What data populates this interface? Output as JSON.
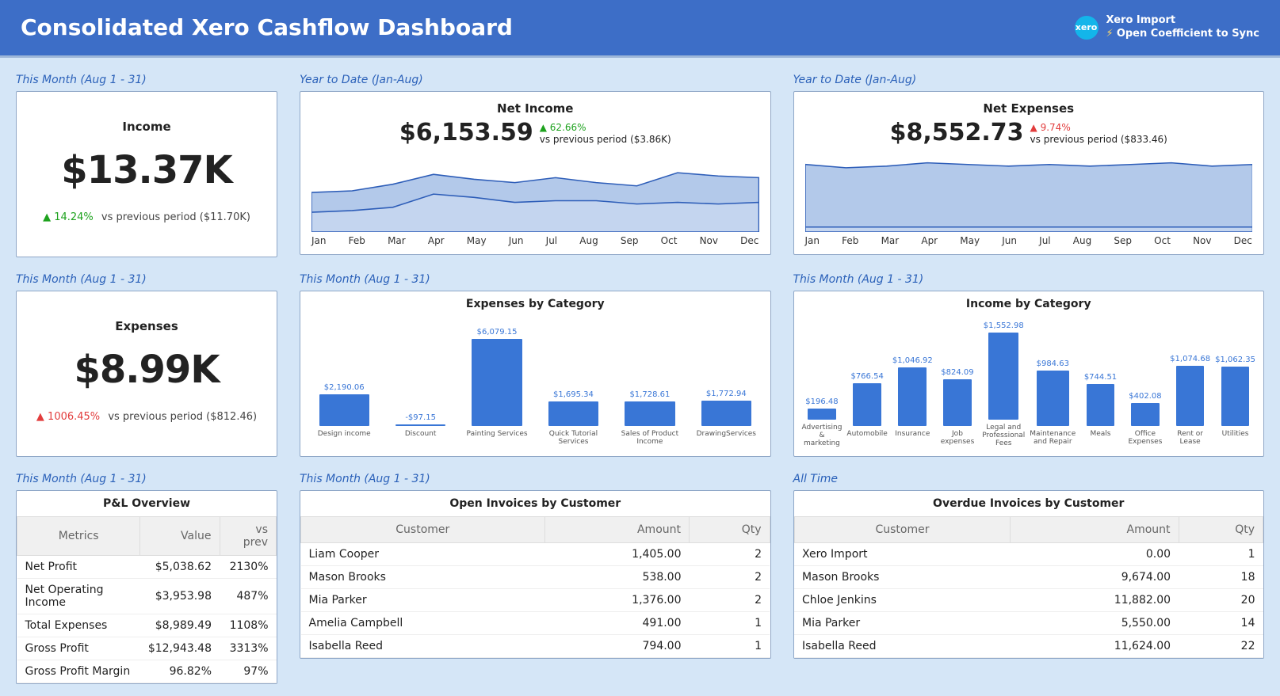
{
  "header": {
    "title": "Consolidated Xero Cashflow Dashboard",
    "import_label": "Xero Import",
    "sync_label": "Open Coefficient to Sync",
    "logo": "xero"
  },
  "labels": {
    "this_month": "This Month (Aug 1 - 31)",
    "ytd": "Year to Date (Jan-Aug)",
    "all_time": "All Time"
  },
  "income": {
    "title": "Income",
    "value": "$13.37K",
    "delta_pct": "14.24%",
    "delta_dir": "up",
    "prev": "vs previous period ($11.70K)"
  },
  "expenses": {
    "title": "Expenses",
    "value": "$8.99K",
    "delta_pct": "1006.45%",
    "delta_dir": "down",
    "prev": "vs previous period ($812.46)"
  },
  "net_income": {
    "title": "Net Income",
    "value": "$6,153.59",
    "delta_pct": "62.66%",
    "delta_dir": "up",
    "prev": "vs previous period ($3.86K)"
  },
  "net_expenses": {
    "title": "Net Expenses",
    "value": "$8,552.73",
    "delta_pct": "9.74%",
    "delta_dir": "down",
    "prev": "vs previous period ($833.46)"
  },
  "months": [
    "Jan",
    "Feb",
    "Mar",
    "Apr",
    "May",
    "Jun",
    "Jul",
    "Aug",
    "Sep",
    "Oct",
    "Nov",
    "Dec"
  ],
  "expenses_by_cat": {
    "title": "Expenses by Category"
  },
  "income_by_cat": {
    "title": "Income by Category"
  },
  "pnl": {
    "title": "P&L Overview",
    "cols": [
      "Metrics",
      "Value",
      "vs prev"
    ],
    "rows": [
      [
        "Net Profit",
        "$5,038.62",
        "2130%"
      ],
      [
        "Net Operating Income",
        "$3,953.98",
        "487%"
      ],
      [
        "Total Expenses",
        "$8,989.49",
        "1108%"
      ],
      [
        "Gross Profit",
        "$12,943.48",
        "3313%"
      ],
      [
        "Gross Profit Margin",
        "96.82%",
        "97%"
      ]
    ]
  },
  "open_inv": {
    "title": "Open Invoices by Customer",
    "cols": [
      "Customer",
      "Amount",
      "Qty"
    ],
    "rows": [
      [
        "Liam Cooper",
        "1,405.00",
        "2"
      ],
      [
        "Mason Brooks",
        "538.00",
        "2"
      ],
      [
        "Mia Parker",
        "1,376.00",
        "2"
      ],
      [
        "Amelia Campbell",
        "491.00",
        "1"
      ],
      [
        "Isabella Reed",
        "794.00",
        "1"
      ]
    ]
  },
  "overdue_inv": {
    "title": "Overdue Invoices by Customer",
    "cols": [
      "Customer",
      "Amount",
      "Qty"
    ],
    "rows": [
      [
        "Xero Import",
        "0.00",
        "1"
      ],
      [
        "Mason Brooks",
        "9,674.00",
        "18"
      ],
      [
        "Chloe Jenkins",
        "11,882.00",
        "20"
      ],
      [
        "Mia Parker",
        "5,550.00",
        "14"
      ],
      [
        "Isabella Reed",
        "11,624.00",
        "22"
      ]
    ]
  },
  "chart_data": [
    {
      "id": "net_income_area",
      "type": "area",
      "title": "Net Income",
      "x": [
        "Jan",
        "Feb",
        "Mar",
        "Apr",
        "May",
        "Jun",
        "Jul",
        "Aug",
        "Sep",
        "Oct",
        "Nov",
        "Dec"
      ],
      "series": [
        {
          "name": "current",
          "values": [
            48,
            50,
            58,
            70,
            64,
            60,
            66,
            60,
            56,
            72,
            68,
            66
          ]
        },
        {
          "name": "previous",
          "values": [
            24,
            26,
            30,
            46,
            42,
            36,
            38,
            38,
            34,
            36,
            34,
            36
          ]
        }
      ],
      "ylim": [
        0,
        100
      ]
    },
    {
      "id": "net_expenses_area",
      "type": "area",
      "title": "Net Expenses",
      "x": [
        "Jan",
        "Feb",
        "Mar",
        "Apr",
        "May",
        "Jun",
        "Jul",
        "Aug",
        "Sep",
        "Oct",
        "Nov",
        "Dec"
      ],
      "series": [
        {
          "name": "current",
          "values": [
            82,
            78,
            80,
            84,
            82,
            80,
            82,
            80,
            82,
            84,
            80,
            82
          ]
        },
        {
          "name": "previous",
          "values": [
            6,
            6,
            6,
            6,
            6,
            6,
            6,
            6,
            6,
            6,
            6,
            6
          ]
        }
      ],
      "ylim": [
        0,
        100
      ]
    },
    {
      "id": "expenses_by_category",
      "type": "bar",
      "title": "Expenses by Category",
      "categories": [
        "Design income",
        "Discount",
        "Painting Services",
        "Quick Tutorial Services",
        "Sales of Product Income",
        "DrawingServices"
      ],
      "values": [
        2190.06,
        -97.15,
        6079.15,
        1695.34,
        1728.61,
        1772.94
      ],
      "labels": [
        "$2,190.06",
        "-$97.15",
        "$6,079.15",
        "$1,695.34",
        "$1,728.61",
        "$1,772.94"
      ]
    },
    {
      "id": "income_by_category",
      "type": "bar",
      "title": "Income by Category",
      "categories": [
        "Advertising & marketing",
        "Automobile",
        "Insurance",
        "Job expenses",
        "Legal and Professional Fees",
        "Maintenance and Repair",
        "Meals",
        "Office Expenses",
        "Rent or Lease",
        "Utilities"
      ],
      "values": [
        196.48,
        766.54,
        1046.92,
        824.09,
        1552.98,
        984.63,
        744.51,
        402.08,
        1074.68,
        1062.35
      ],
      "labels": [
        "$196.48",
        "$766.54",
        "$1,046.92",
        "$824.09",
        "$1,552.98",
        "$984.63",
        "$744.51",
        "$402.08",
        "$1,074.68",
        "$1,062.35"
      ]
    }
  ]
}
